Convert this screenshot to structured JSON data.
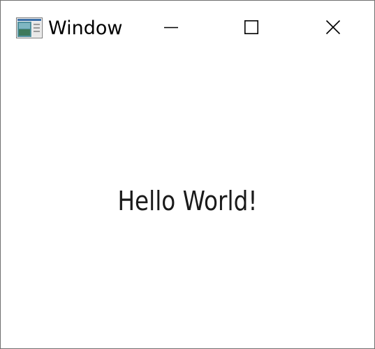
{
  "window": {
    "title": "Window",
    "app_icon": "app-window-icon",
    "buttons": {
      "minimize_icon": "minimize-icon",
      "maximize_icon": "maximize-icon",
      "close_icon": "close-icon"
    }
  },
  "content": {
    "label": "Hello World!"
  }
}
